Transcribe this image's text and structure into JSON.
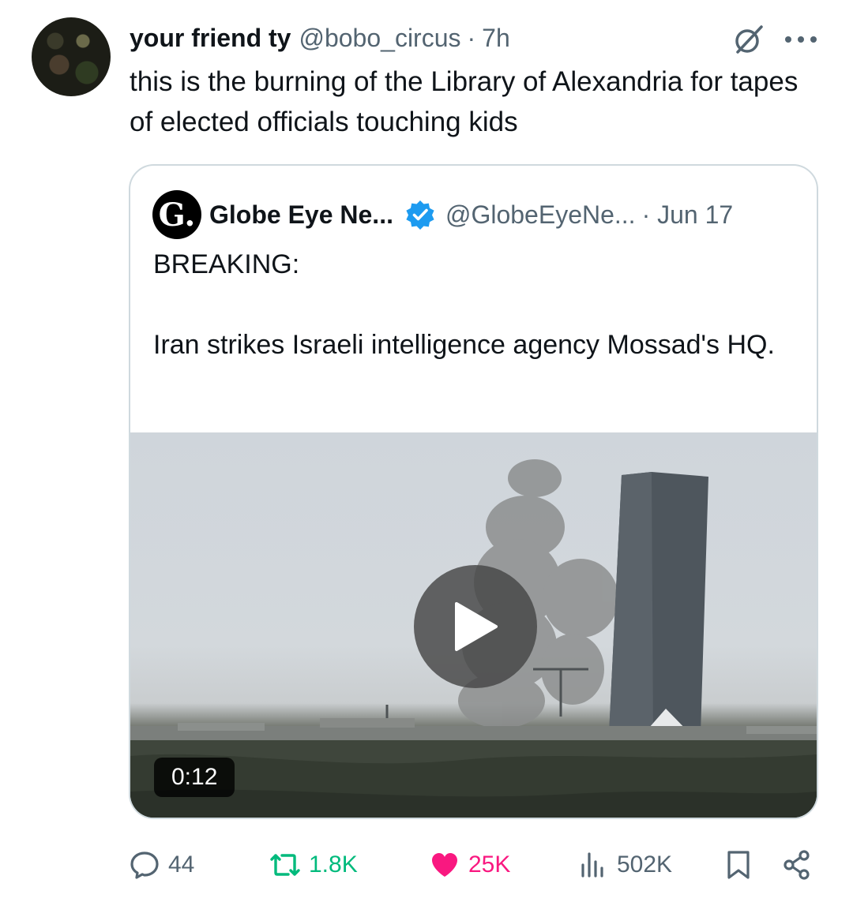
{
  "tweet": {
    "display_name": "your friend ty",
    "handle": "@bobo_circus",
    "separator": "·",
    "time": "7h",
    "text": "this is the burning of the Library of Alexandria for tapes of elected officials touching kids"
  },
  "quote": {
    "avatar_letter": "G.",
    "display_name": "Globe Eye Ne...",
    "handle": "@GlobeEyeNe...",
    "date": "· Jun 17",
    "text": "BREAKING:\n\nIran strikes Israeli intelligence agency Mossad's HQ.",
    "media": {
      "duration": "0:12"
    }
  },
  "actions": {
    "replies": "44",
    "reposts": "1.8K",
    "likes": "25K",
    "views": "502K"
  },
  "colors": {
    "repost_active": "#00ba7c",
    "like_active": "#f91880",
    "verified": "#1d9bf0",
    "secondary_text": "#536471"
  },
  "icons": [
    "grok-icon",
    "more-icon",
    "verified-badge-icon",
    "play-icon",
    "reply-icon",
    "repost-icon",
    "like-icon",
    "views-icon",
    "bookmark-icon",
    "share-icon"
  ]
}
